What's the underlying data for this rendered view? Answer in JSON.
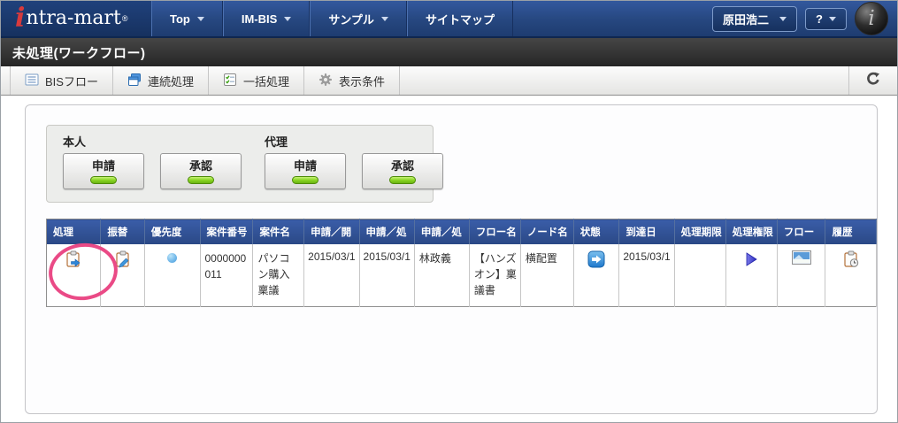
{
  "nav": {
    "logo": {
      "i": "i",
      "text": "ntra-mart",
      "reg": "®"
    },
    "items": [
      {
        "label": "Top"
      },
      {
        "label": "IM-BIS"
      },
      {
        "label": "サンプル"
      },
      {
        "label": "サイトマップ"
      }
    ],
    "user_name": "原田浩二",
    "help_label": "?",
    "badge_glyph": "i"
  },
  "title_bar": {
    "title": "未処理(ワークフロー)"
  },
  "toolbar": {
    "buttons": [
      {
        "label": "BISフロー",
        "icon": "list-icon"
      },
      {
        "label": "連続処理",
        "icon": "cascade-windows-icon"
      },
      {
        "label": "一括処理",
        "icon": "checklist-icon"
      },
      {
        "label": "表示条件",
        "icon": "gear-icon"
      }
    ],
    "refresh_icon": "refresh-icon"
  },
  "filter_panel": {
    "groups": [
      {
        "label": "本人",
        "buttons": [
          {
            "label": "申請"
          },
          {
            "label": "承認"
          }
        ]
      },
      {
        "label": "代理",
        "buttons": [
          {
            "label": "申請"
          },
          {
            "label": "承認"
          }
        ]
      }
    ]
  },
  "table": {
    "headers": [
      "処理",
      "振替",
      "優先度",
      "案件番号",
      "案件名",
      "申請／開",
      "申請／処",
      "申請／処",
      "フロー名",
      "ノード名",
      "状態",
      "到達日",
      "処理期限",
      "処理権限",
      "フロー",
      "履歴"
    ],
    "rows": [
      {
        "process_icon": "clipboard-forward-icon",
        "transfer_icon": "clipboard-edit-icon",
        "priority_icon": "blue-dot-icon",
        "case_number": "0000000011",
        "case_name": "パソコン購入稟議",
        "apply_start_date": "2015/03/1",
        "apply_process_date": "2015/03/1",
        "applicant": "林政義",
        "flow_name": "【ハンズオン】稟議書",
        "node_name": "横配置",
        "status_icon": "blue-arrow-badge-icon",
        "arrival_date": "2015/03/1",
        "process_deadline": "",
        "authority_icon": "play-triangle-icon",
        "flow_icon": "flow-image-icon",
        "history_icon": "clipboard-clock-icon"
      }
    ]
  },
  "annotation": {
    "shape": "ellipse",
    "color": "#ea4a86"
  },
  "colors": {
    "nav_blue": "#26477f",
    "table_header_blue": "#2a4885",
    "accent_green": "#86d320",
    "annotation_pink": "#ea4a86",
    "status_blue": "#2f86d2"
  }
}
